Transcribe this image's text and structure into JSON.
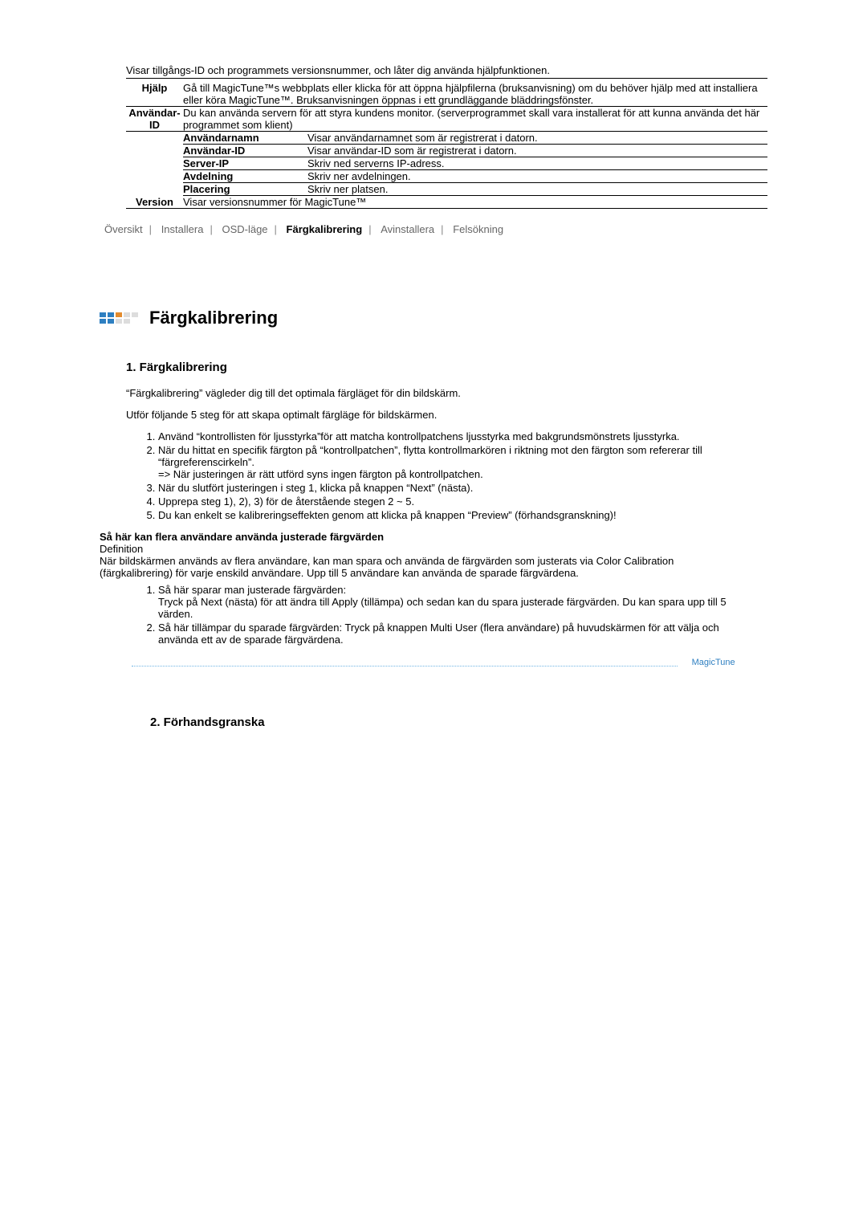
{
  "intro": "Visar tillgångs-ID och programmets versionsnummer, och låter dig använda hjälpfunktionen.",
  "rows": {
    "help": {
      "label": "Hjälp",
      "body": "Gå till MagicTune™s webbplats eller klicka för att öppna hjälpfilerna (bruksanvisning) om du behöver hjälp med att installiera eller köra MagicTune™. Bruksanvisningen öppnas i ett grundläggande bläddringsfönster."
    },
    "userid": {
      "label": "Användar-ID",
      "body": "Du kan använda servern för att styra kundens monitor. (serverprogrammet skall vara installerat för att kunna använda det här programmet som klient)",
      "sub": [
        {
          "label": "Användarnamn",
          "body": "Visar användarnamnet som är registrerat i datorn."
        },
        {
          "label": "Användar-ID",
          "body": "Visar användar-ID som är registrerat i datorn."
        },
        {
          "label": "Server-IP",
          "body": "Skriv ned serverns IP-adress."
        },
        {
          "label": "Avdelning",
          "body": "Skriv ner avdelningen."
        },
        {
          "label": "Placering",
          "body": "Skriv ner platsen."
        }
      ]
    },
    "version": {
      "label": "Version",
      "body": "Visar versionsnummer för MagicTune™"
    }
  },
  "tabs": {
    "overview": "Översikt",
    "install": "Installera",
    "osd": "OSD-läge",
    "color": "Färgkalibrering",
    "uninstall": "Avinstallera",
    "trouble": "Felsökning"
  },
  "section": {
    "title": "Färgkalibrering",
    "h1": "1. Färgkalibrering",
    "p1": "“Färgkalibrering” vägleder dig till det optimala färgläget för din bildskärm.",
    "p2": "Utför följande 5 steg för att skapa optimalt färgläge för bildskärmen.",
    "steps": [
      "Använd “kontrollisten för ljusstyrka”för att matcha kontrollpatchens ljusstyrka med bakgrundsmönstrets ljusstyrka.",
      "När du hittat en specifik färgton på “kontrollpatchen”, flytta kontrollmarkören i riktning mot den färgton som refererar till “färgreferenscirkeln”.\n=> När justeringen är rätt utförd syns ingen färgton på kontrollpatchen.",
      "När du slutfört justeringen i steg 1, klicka på knappen “Next” (nästa).",
      "Upprepa steg 1), 2), 3) för de återstående stegen 2 ~ 5.",
      "Du kan enkelt se kalibreringseffekten genom att klicka på knappen “Preview” (förhandsgranskning)!"
    ],
    "multi_title": "Så här kan flera användare använda justerade färgvärden",
    "multi_def": "Definition",
    "multi_para": "När bildskärmen används av flera användare, kan man spara och använda de färgvärden som justerats via Color Calibration (färgkalibrering) för varje enskild användare. Upp till 5 användare kan använda de sparade färgvärdena.",
    "multi_list": [
      "Så här sparar man justerade färgvärden:\nTryck på Next (nästa) för att ändra till Apply (tillämpa) och sedan kan du spara justerade färgvärden. Du kan spara upp till 5 värden.",
      "Så här tillämpar du sparade färgvärden: Tryck på knappen Multi User (flera användare) på huvudskärmen för att välja och använda ett av de sparade färgvärdena."
    ],
    "logo": "MagicTune",
    "h2": "2. Förhandsgranska"
  }
}
